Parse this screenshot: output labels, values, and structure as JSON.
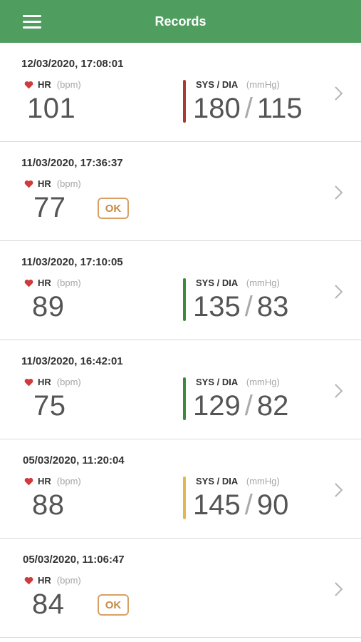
{
  "header": {
    "title": "Records",
    "menu_icon": "hamburger-menu-icon",
    "color": "#4f9d5f"
  },
  "labels": {
    "hr": "HR",
    "hr_unit": "(bpm)",
    "bp": "SYS / DIA",
    "bp_unit": "(mmHg)",
    "ok": "OK"
  },
  "status_colors": {
    "high": "#a83a2f",
    "normal": "#3a8a3a",
    "elevated": "#e2b84d"
  },
  "records": [
    {
      "timestamp": "12/03/2020, 17:08:01",
      "hr": "101",
      "sys": "180",
      "dia": "115",
      "status": "high"
    },
    {
      "timestamp": "11/03/2020, 17:36:37",
      "hr": "77",
      "status": "ok"
    },
    {
      "timestamp": "11/03/2020, 17:10:05",
      "hr": "89",
      "sys": "135",
      "dia": "83",
      "status": "normal"
    },
    {
      "timestamp": "11/03/2020, 16:42:01",
      "hr": "75",
      "sys": "129",
      "dia": "82",
      "status": "normal"
    },
    {
      "timestamp": "05/03/2020, 11:20:04",
      "hr": "88",
      "sys": "145",
      "dia": "90",
      "status": "elevated"
    },
    {
      "timestamp": "05/03/2020, 11:06:47",
      "hr": "84",
      "status": "ok"
    }
  ]
}
